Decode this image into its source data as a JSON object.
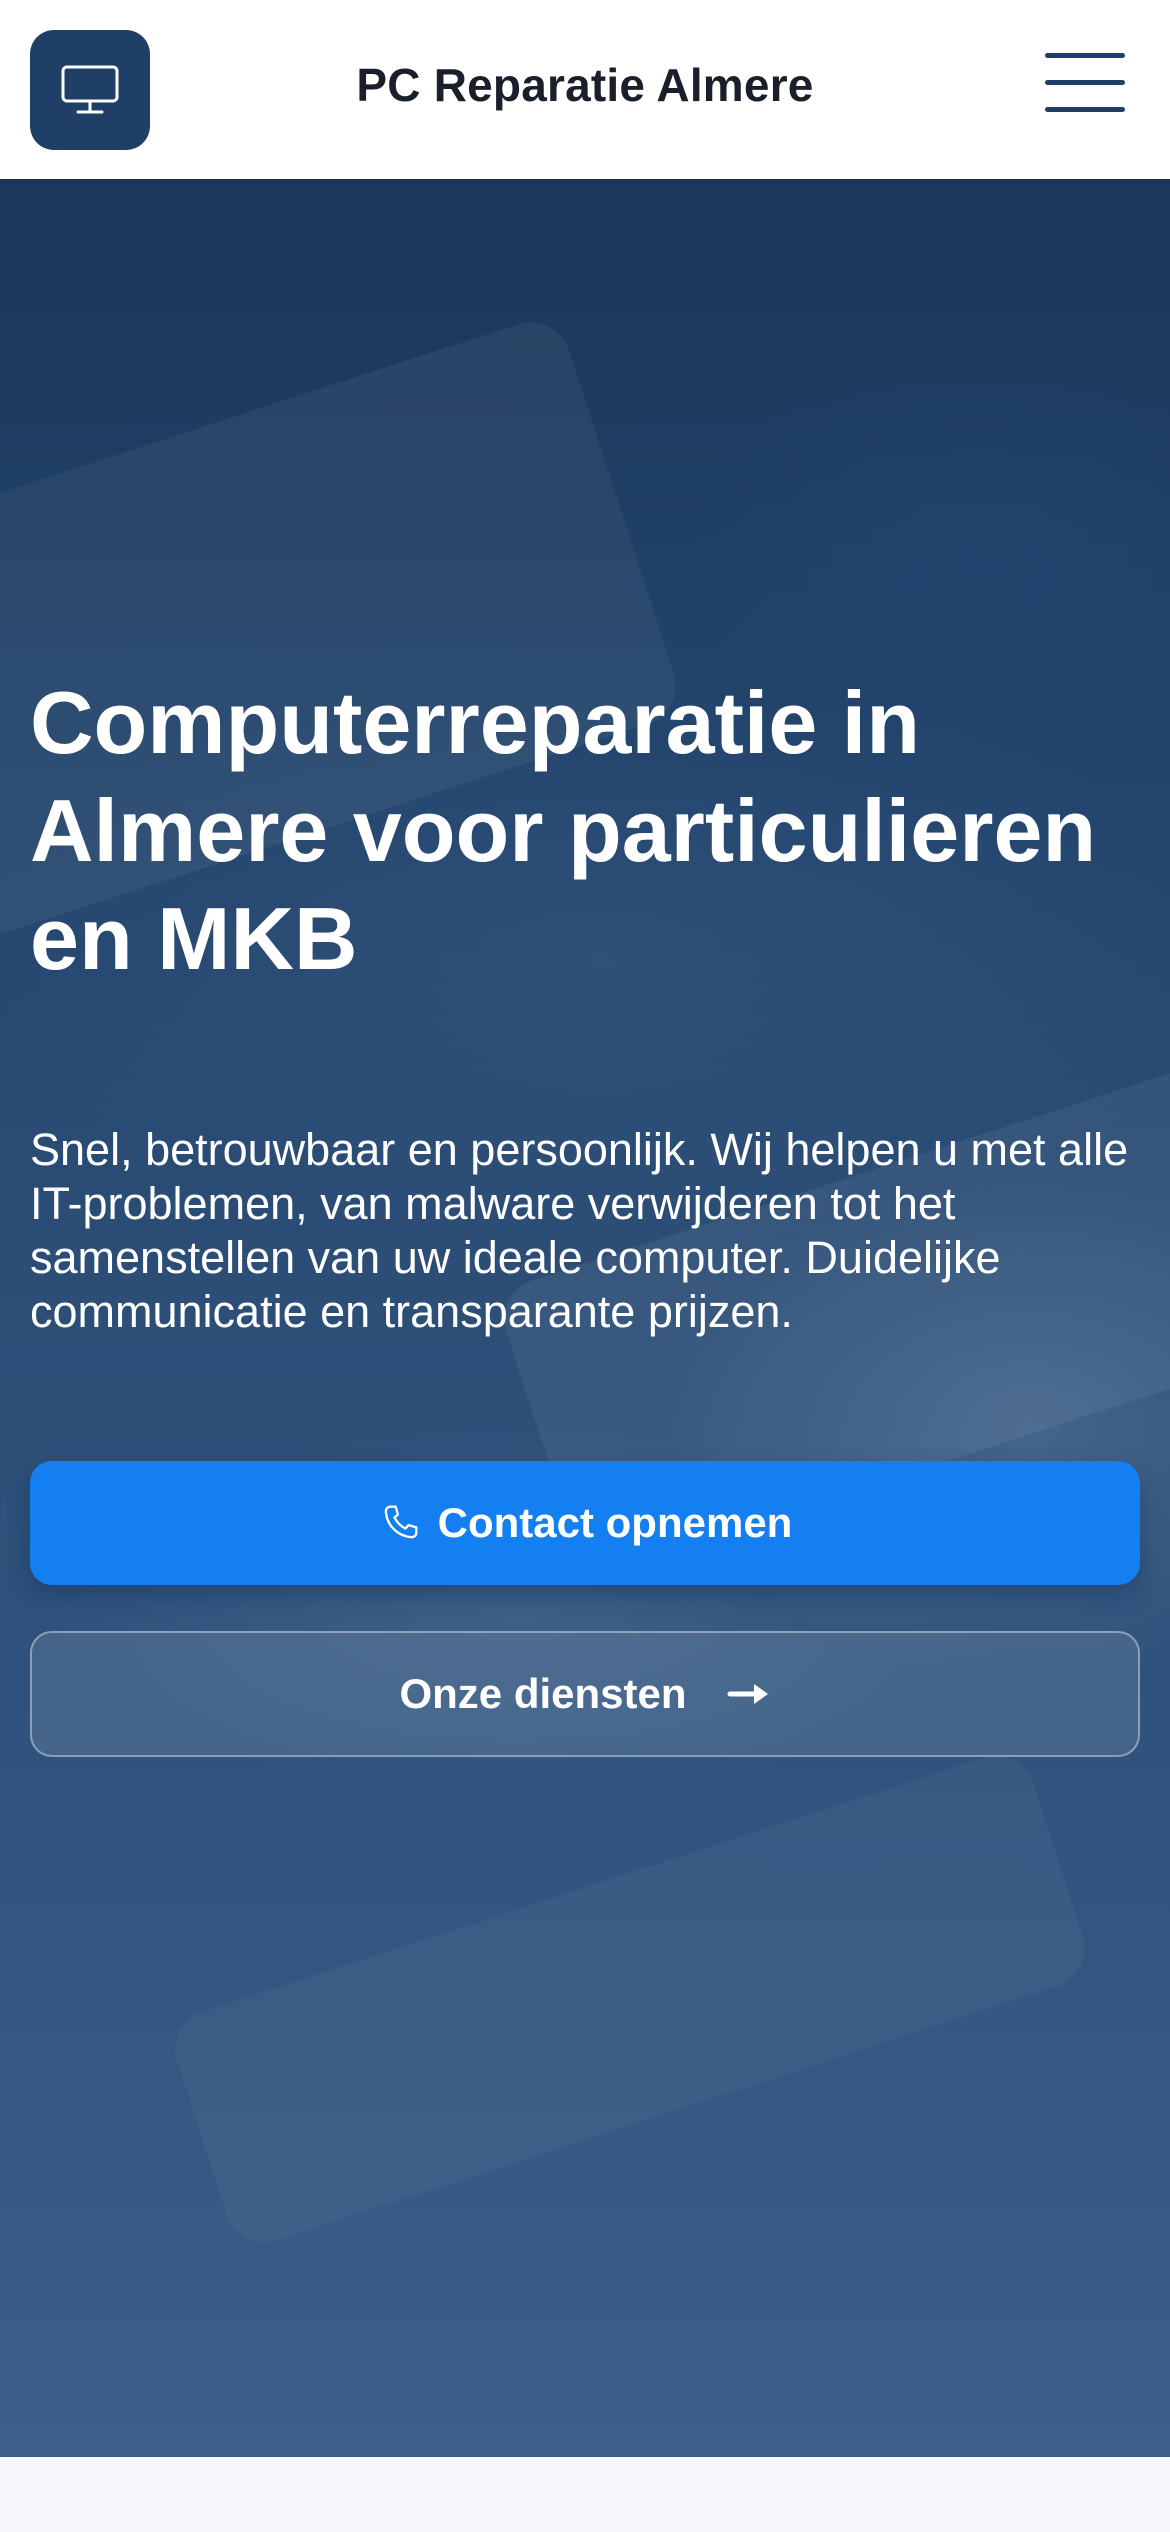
{
  "header": {
    "site_title": "PC Reparatie Almere",
    "logo_icon": "monitor-icon",
    "menu_icon": "hamburger-menu-icon"
  },
  "hero": {
    "title": "Computerreparatie in Almere voor particulieren en MKB",
    "description": "Snel, betrouwbaar en persoonlijk. Wij helpen u met alle IT-problemen, van malware verwijderen tot het samenstellen van uw ideale computer. Duidelijke communicatie en transparante prijzen.",
    "primary_button": {
      "label": "Contact opnemen",
      "icon": "phone-icon"
    },
    "secondary_button": {
      "label": "Onze diensten",
      "icon": "arrow-right-icon"
    }
  },
  "colors": {
    "brand_navy": "#1f3f66",
    "accent_blue": "#137ff0",
    "hero_background": "#2c4e77",
    "page_background": "#f5f7fa"
  }
}
